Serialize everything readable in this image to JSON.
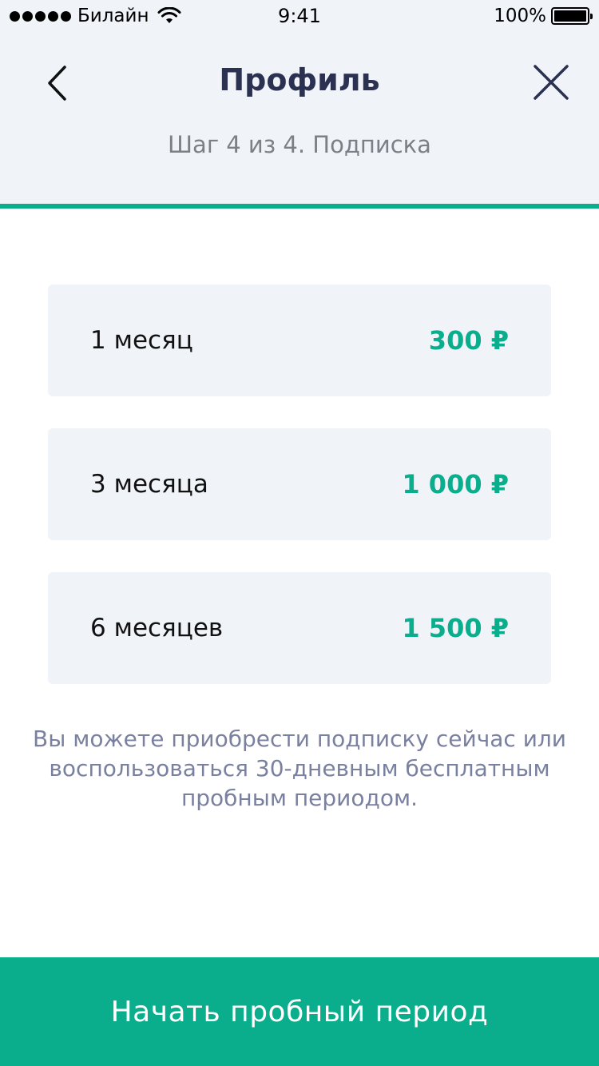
{
  "status_bar": {
    "carrier": "Билайн",
    "time": "9:41",
    "battery": "100%"
  },
  "header": {
    "title": "Профиль",
    "step": "Шаг 4 из 4. Подписка",
    "back_icon": "chevron-left-icon",
    "close_icon": "close-icon"
  },
  "plans": [
    {
      "name": "1 месяц",
      "price": "300 ₽"
    },
    {
      "name": "3 месяца",
      "price": "1 000 ₽"
    },
    {
      "name": "6 месяцев",
      "price": "1 500 ₽"
    }
  ],
  "info_text": "Вы можете приобрести подписку сейчас или воспользоваться 30-дневным бесплатным пробным периодом.",
  "cta_label": "Начать пробный период",
  "colors": {
    "accent": "#0aae8d",
    "header_bg": "#f0f3f8",
    "title": "#2b3150"
  }
}
